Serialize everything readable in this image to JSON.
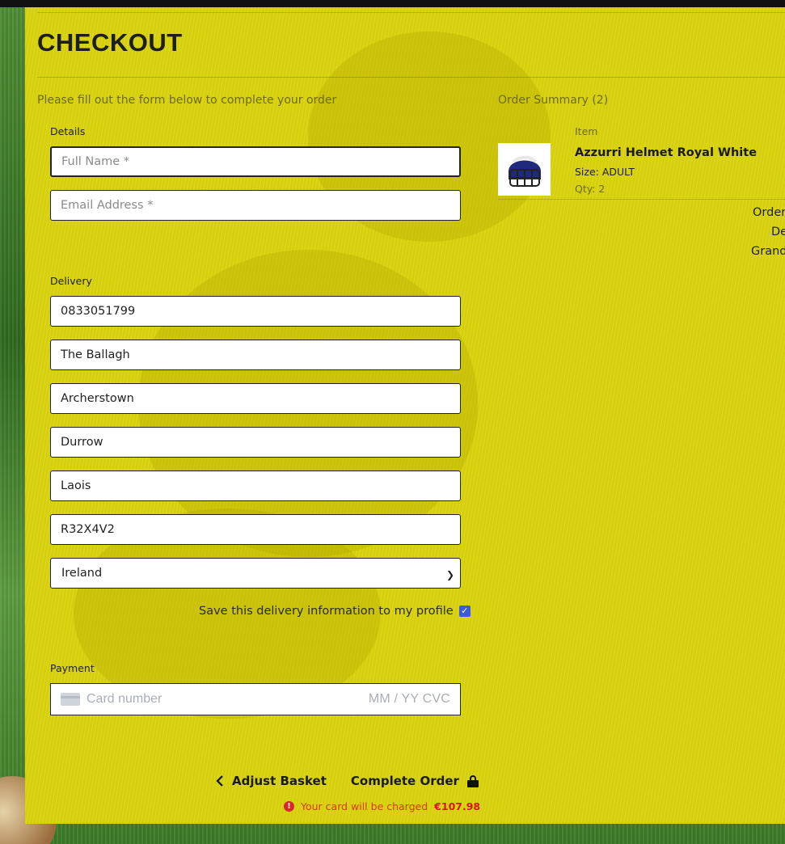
{
  "page": {
    "title": "CHECKOUT",
    "lead": "Please fill out the form below to complete your order"
  },
  "details": {
    "label": "Details",
    "full_name": {
      "value": "",
      "placeholder": "Full Name *"
    },
    "email": {
      "value": "",
      "placeholder": "Email Address *"
    }
  },
  "delivery": {
    "label": "Delivery",
    "phone": "0833051799",
    "street1": "The Ballagh",
    "street2": "Archerstown",
    "town": "Durrow",
    "county": "Laois",
    "postcode": "R32X4V2",
    "country": "Ireland",
    "save_label": "Save this delivery information to my profile",
    "save_checked": true
  },
  "payment": {
    "label": "Payment",
    "card_placeholder": "Card number",
    "expiry_cvc_placeholder": "MM / YY  CVC"
  },
  "actions": {
    "adjust_label": "Adjust Basket",
    "complete_label": "Complete Order",
    "charge_text": "Your card will be charged",
    "charge_amount": "€107.98"
  },
  "summary": {
    "heading": "Order Summary (2)",
    "item_col_label": "Item",
    "items": [
      {
        "name": "Azzurri Helmet Royal White",
        "size": "Size: ADULT",
        "qty": "Qty: 2",
        "thumb_icon": "helmet-icon"
      }
    ],
    "totals_visible": [
      "Order",
      "De",
      "Grand"
    ]
  },
  "colors": {
    "panel": "#dcd60f",
    "alert": "#d83a1a",
    "checkbox": "#3b5bd9"
  }
}
